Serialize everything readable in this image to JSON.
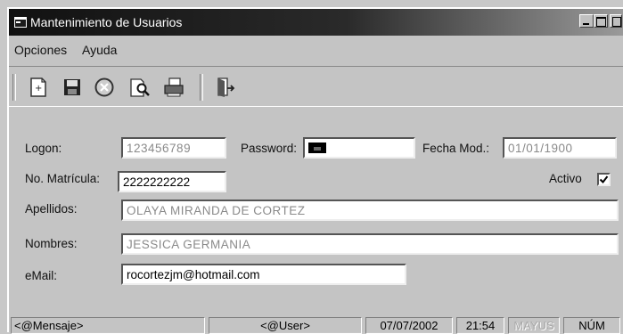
{
  "window": {
    "title": "Mantenimiento de Usuarios"
  },
  "menu": {
    "items": [
      "Opciones",
      "Ayuda"
    ]
  },
  "toolbar": {
    "buttons": [
      "new-icon",
      "save-icon",
      "cancel-icon",
      "search-icon",
      "print-icon",
      "exit-icon"
    ]
  },
  "form": {
    "logon": {
      "label": "Logon:",
      "value": "123456789"
    },
    "password": {
      "label": "Password:"
    },
    "fecha_mod": {
      "label": "Fecha Mod.:",
      "value": "01/01/1900"
    },
    "matricula": {
      "label": "No. Matrícula:",
      "value": "2222222222"
    },
    "activo": {
      "label": "Activo",
      "checked": true
    },
    "apellidos": {
      "label": "Apellidos:",
      "value": "OLAYA MIRANDA DE CORTEZ"
    },
    "nombres": {
      "label": "Nombres:",
      "value": "JESSICA GERMANIA"
    },
    "email": {
      "label": "eMail:",
      "value": "rocortezjm@hotmail.com"
    }
  },
  "status": {
    "message": "<@Mensaje>",
    "user": "<@User>",
    "date": "07/07/2002",
    "time": "21:54",
    "caps": "MAYUS",
    "num": "NÚM"
  }
}
